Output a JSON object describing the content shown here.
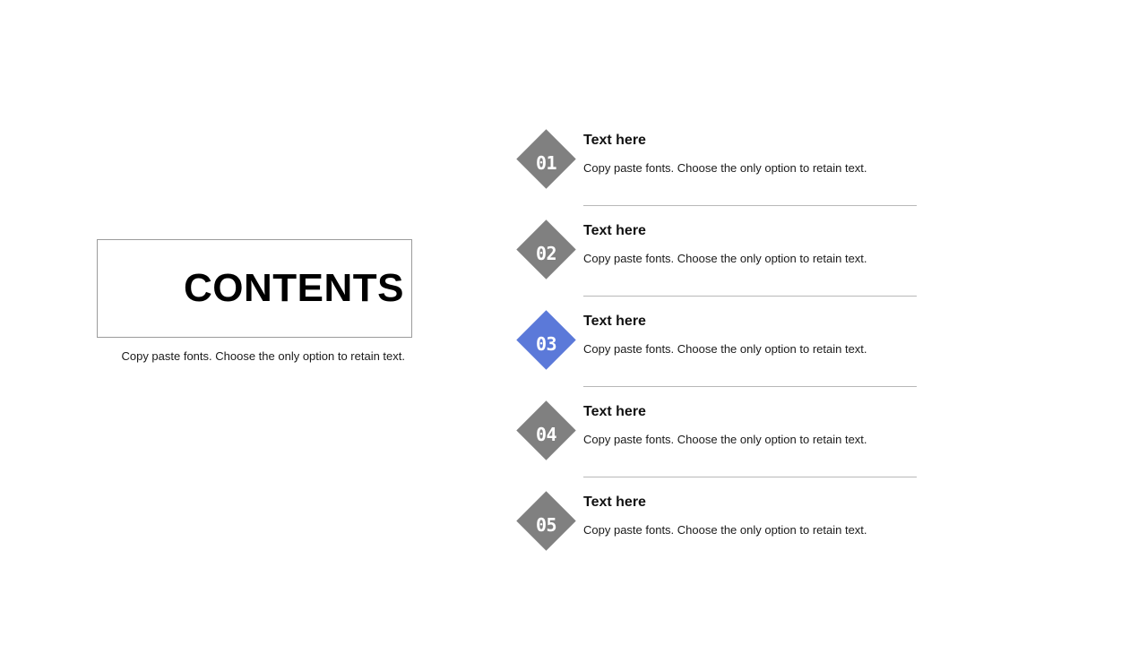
{
  "slide": {
    "background_color": "#ffffff",
    "accent_color": "#5b79d9",
    "neutral_color": "#808080",
    "divider_color": "#b8b8b8",
    "frame_border_color": "#9b9b9b"
  },
  "title_block": {
    "title": "CONTENTS",
    "caption": "Copy paste fonts. Choose the only option to retain text."
  },
  "items": [
    {
      "number": "01",
      "heading": "Text here",
      "description": "Copy paste fonts. Choose the only option to retain text.",
      "color": "#808080",
      "active": false
    },
    {
      "number": "02",
      "heading": "Text here",
      "description": "Copy paste fonts. Choose the only option to retain text.",
      "color": "#808080",
      "active": false
    },
    {
      "number": "03",
      "heading": "Text here",
      "description": "Copy paste fonts. Choose the only option to retain text.",
      "color": "#5b79d9",
      "active": true
    },
    {
      "number": "04",
      "heading": "Text here",
      "description": "Copy paste fonts. Choose the only option to retain text.",
      "color": "#808080",
      "active": false
    },
    {
      "number": "05",
      "heading": "Text here",
      "description": "Copy paste fonts. Choose the only option to retain text.",
      "color": "#808080",
      "active": false
    }
  ]
}
